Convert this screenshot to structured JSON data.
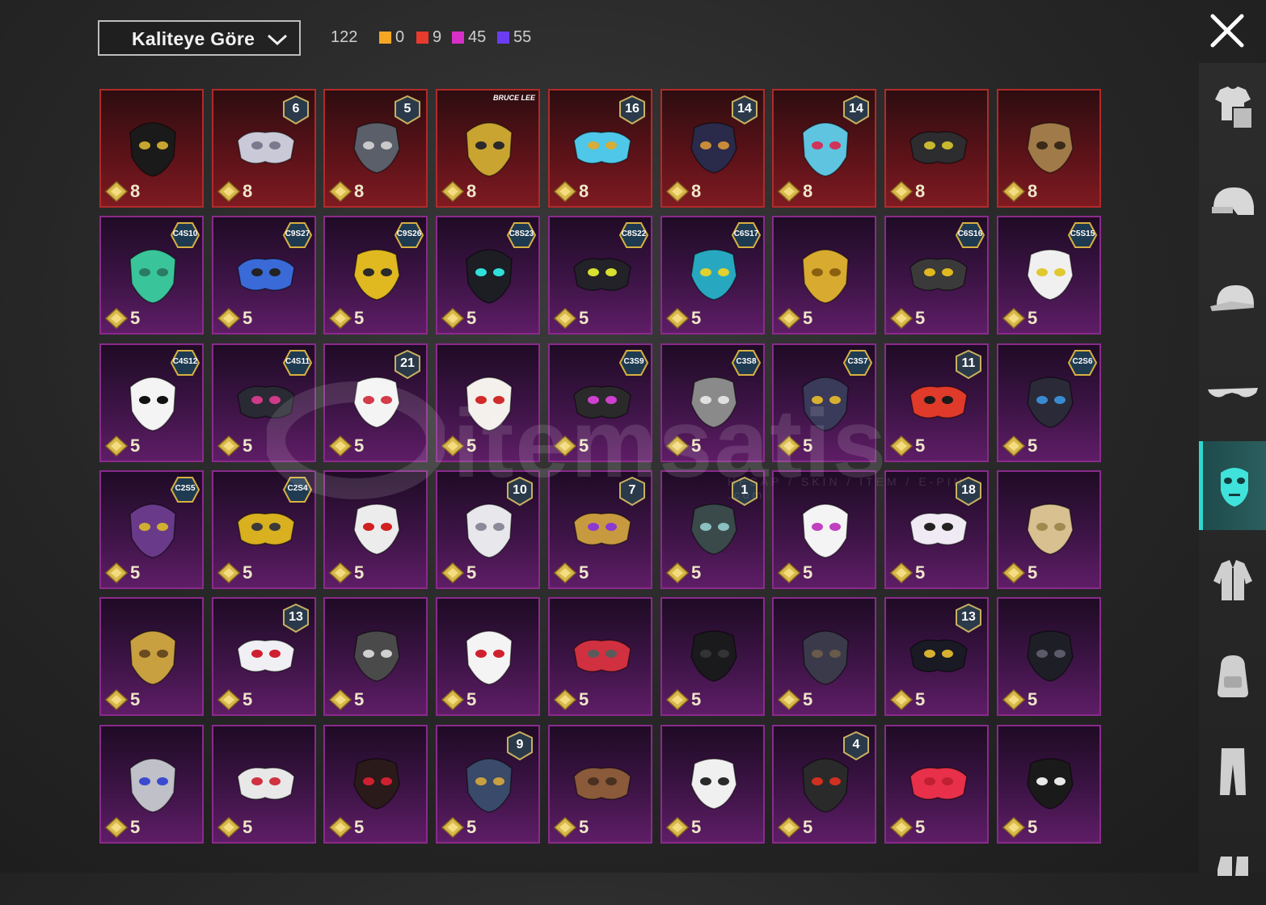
{
  "sort": {
    "label": "Kaliteye Göre"
  },
  "stats": {
    "total": "122",
    "qualities": [
      {
        "name": "legendary",
        "color": "#f5a623",
        "count": "0"
      },
      {
        "name": "mythic",
        "color": "#e83a2d",
        "count": "9"
      },
      {
        "name": "epic",
        "color": "#d82fc8",
        "count": "45"
      },
      {
        "name": "rare",
        "color": "#6a3df0",
        "count": "55"
      }
    ]
  },
  "close_icon": "close-icon",
  "sidebar": {
    "items": [
      {
        "name": "outfit",
        "icon": "outfit-icon"
      },
      {
        "name": "helmet",
        "icon": "helmet-icon"
      },
      {
        "name": "cap",
        "icon": "cap-icon"
      },
      {
        "name": "glasses",
        "icon": "glasses-icon"
      },
      {
        "name": "mask",
        "icon": "mask-icon",
        "active": true
      },
      {
        "name": "jacket",
        "icon": "jacket-icon"
      },
      {
        "name": "backpack",
        "icon": "backpack-icon"
      },
      {
        "name": "pants",
        "icon": "pants-icon"
      },
      {
        "name": "shoes",
        "icon": "shoes-icon"
      }
    ]
  },
  "items": [
    {
      "quality": "red",
      "price": "8",
      "color": "#1a1a1a",
      "accent": "#c8a530"
    },
    {
      "quality": "red",
      "price": "8",
      "badge": "6",
      "badge_type": "level",
      "color": "#c9c9d8",
      "accent": "#7a7a8e"
    },
    {
      "quality": "red",
      "price": "8",
      "badge": "5",
      "badge_type": "level",
      "color": "#5a5f6a",
      "accent": "#c9c9c9"
    },
    {
      "quality": "red",
      "price": "8",
      "badge": "BRUCE LEE",
      "badge_type": "brand",
      "color": "#c9a430",
      "accent": "#2a2a2a"
    },
    {
      "quality": "red",
      "price": "8",
      "badge": "16",
      "badge_type": "level",
      "color": "#4ec7e8",
      "accent": "#d6ad3a"
    },
    {
      "quality": "red",
      "price": "8",
      "badge": "14",
      "badge_type": "level",
      "color": "#2a2a4a",
      "accent": "#c98b3a"
    },
    {
      "quality": "red",
      "price": "8",
      "badge": "14",
      "badge_type": "level",
      "color": "#5ec4e0",
      "accent": "#d0345a"
    },
    {
      "quality": "red",
      "price": "8",
      "color": "#2d2d30",
      "accent": "#c8b830"
    },
    {
      "quality": "red",
      "price": "8",
      "color": "#a07a48",
      "accent": "#3a2a18"
    },
    {
      "quality": "purple",
      "price": "5",
      "badge": "C4S10",
      "badge_type": "season",
      "color": "#3ac49a",
      "accent": "#2a7a64"
    },
    {
      "quality": "purple",
      "price": "5",
      "badge": "C9S27",
      "badge_type": "season",
      "color": "#3a6ad8",
      "accent": "#222"
    },
    {
      "quality": "purple",
      "price": "5",
      "badge": "C9S26",
      "badge_type": "season",
      "color": "#e0b820",
      "accent": "#2a2a2a"
    },
    {
      "quality": "purple",
      "price": "5",
      "badge": "C8S23",
      "badge_type": "season",
      "color": "#1d1d24",
      "accent": "#30e0d8"
    },
    {
      "quality": "purple",
      "price": "5",
      "badge": "C8S22",
      "badge_type": "season",
      "color": "#222228",
      "accent": "#d8e030"
    },
    {
      "quality": "purple",
      "price": "5",
      "badge": "C6S17",
      "badge_type": "season",
      "color": "#28a8c0",
      "accent": "#e0d030"
    },
    {
      "quality": "purple",
      "price": "5",
      "color": "#d8aa30",
      "accent": "#8a6010"
    },
    {
      "quality": "purple",
      "price": "5",
      "badge": "C6S16",
      "badge_type": "season",
      "color": "#3a3a3a",
      "accent": "#e0b820"
    },
    {
      "quality": "purple",
      "price": "5",
      "badge": "C5S15",
      "badge_type": "season",
      "color": "#f0f0f0",
      "accent": "#e0c830"
    },
    {
      "quality": "purple",
      "price": "5",
      "badge": "C4S12",
      "badge_type": "season",
      "color": "#f4f4f4",
      "accent": "#111"
    },
    {
      "quality": "purple",
      "price": "5",
      "badge": "C4S11",
      "badge_type": "season",
      "color": "#2a2a34",
      "accent": "#d03a8a"
    },
    {
      "quality": "purple",
      "price": "5",
      "badge": "21",
      "badge_type": "level",
      "color": "#f4f4f4",
      "accent": "#d02030"
    },
    {
      "quality": "purple",
      "price": "5",
      "color": "#f4f0ec",
      "accent": "#d02a2a"
    },
    {
      "quality": "purple",
      "price": "5",
      "badge": "C3S9",
      "badge_type": "season",
      "color": "#2a2a2a",
      "accent": "#d040d0"
    },
    {
      "quality": "purple",
      "price": "5",
      "badge": "C3S8",
      "badge_type": "season",
      "color": "#8a8a8a",
      "accent": "#e0e0e0"
    },
    {
      "quality": "purple",
      "price": "5",
      "badge": "C3S7",
      "badge_type": "season",
      "color": "#3a3a5a",
      "accent": "#d8b030"
    },
    {
      "quality": "purple",
      "price": "5",
      "badge": "11",
      "badge_type": "level",
      "color": "#e03a2a",
      "accent": "#1a1a1a"
    },
    {
      "quality": "purple",
      "price": "5",
      "badge": "C2S6",
      "badge_type": "season",
      "color": "#2a2a38",
      "accent": "#3a8ad0"
    },
    {
      "quality": "purple",
      "price": "5",
      "badge": "C2S5",
      "badge_type": "season",
      "color": "#6a3a8a",
      "accent": "#d0b030"
    },
    {
      "quality": "purple",
      "price": "5",
      "badge": "C2S4",
      "badge_type": "season",
      "color": "#d8b020",
      "accent": "#3a3a3a"
    },
    {
      "quality": "purple",
      "price": "5",
      "color": "#ececec",
      "accent": "#d02020"
    },
    {
      "quality": "purple",
      "price": "5",
      "badge": "10",
      "badge_type": "level",
      "color": "#e8e8ec",
      "accent": "#8a8a9a"
    },
    {
      "quality": "purple",
      "price": "5",
      "badge": "7",
      "badge_type": "level",
      "color": "#c89a40",
      "accent": "#8a3ad0"
    },
    {
      "quality": "purple",
      "price": "5",
      "badge": "1",
      "badge_type": "level",
      "color": "#3a4a4a",
      "accent": "#8ac0c0"
    },
    {
      "quality": "purple",
      "price": "5",
      "color": "#f4f4f4",
      "accent": "#c040c0"
    },
    {
      "quality": "purple",
      "price": "5",
      "badge": "18",
      "badge_type": "level",
      "color": "#f0eaf4",
      "accent": "#222"
    },
    {
      "quality": "purple",
      "price": "5",
      "color": "#d8c090",
      "accent": "#a08a50"
    },
    {
      "quality": "purple",
      "price": "5",
      "color": "#c8a040",
      "accent": "#6a4a20"
    },
    {
      "quality": "purple",
      "price": "5",
      "badge": "13",
      "badge_type": "level",
      "color": "#f0f0f4",
      "accent": "#d02030"
    },
    {
      "quality": "purple",
      "price": "5",
      "color": "#4a4a4a",
      "accent": "#d0d0d0"
    },
    {
      "quality": "purple",
      "price": "5",
      "color": "#f4f4f4",
      "accent": "#d02030"
    },
    {
      "quality": "purple",
      "price": "5",
      "color": "#d03040",
      "accent": "#5a5a5a"
    },
    {
      "quality": "purple",
      "price": "5",
      "color": "#1a1a1c",
      "accent": "#333"
    },
    {
      "quality": "purple",
      "price": "5",
      "color": "#3a3a4a",
      "accent": "#6a5a4a"
    },
    {
      "quality": "purple",
      "price": "5",
      "badge": "13",
      "badge_type": "level",
      "color": "#1a1a24",
      "accent": "#d8b030"
    },
    {
      "quality": "purple",
      "price": "5",
      "color": "#1e1e26",
      "accent": "#5a5a6a"
    },
    {
      "quality": "purple",
      "price": "5",
      "color": "#c0c0c8",
      "accent": "#3a4ad0"
    },
    {
      "quality": "purple",
      "price": "5",
      "color": "#e8e8e8",
      "accent": "#d03040"
    },
    {
      "quality": "purple",
      "price": "5",
      "color": "#2a1a1a",
      "accent": "#d02030"
    },
    {
      "quality": "purple",
      "price": "5",
      "badge": "9",
      "badge_type": "level",
      "color": "#3a4a6a",
      "accent": "#c8a040"
    },
    {
      "quality": "purple",
      "price": "5",
      "color": "#8a5a3a",
      "accent": "#4a3020"
    },
    {
      "quality": "purple",
      "price": "5",
      "color": "#f0f0f0",
      "accent": "#2a2a2a"
    },
    {
      "quality": "purple",
      "price": "5",
      "badge": "4",
      "badge_type": "level",
      "color": "#2a2a2a",
      "accent": "#d03020"
    },
    {
      "quality": "purple",
      "price": "5",
      "color": "#e8304a",
      "accent": "#c02030"
    },
    {
      "quality": "purple",
      "price": "5",
      "color": "#1a1a1a",
      "accent": "#e8e8e8"
    }
  ],
  "watermark": {
    "text": "itemsatis",
    "sub": "HESAP / SKIN / ITEM / E-PIN .com"
  }
}
